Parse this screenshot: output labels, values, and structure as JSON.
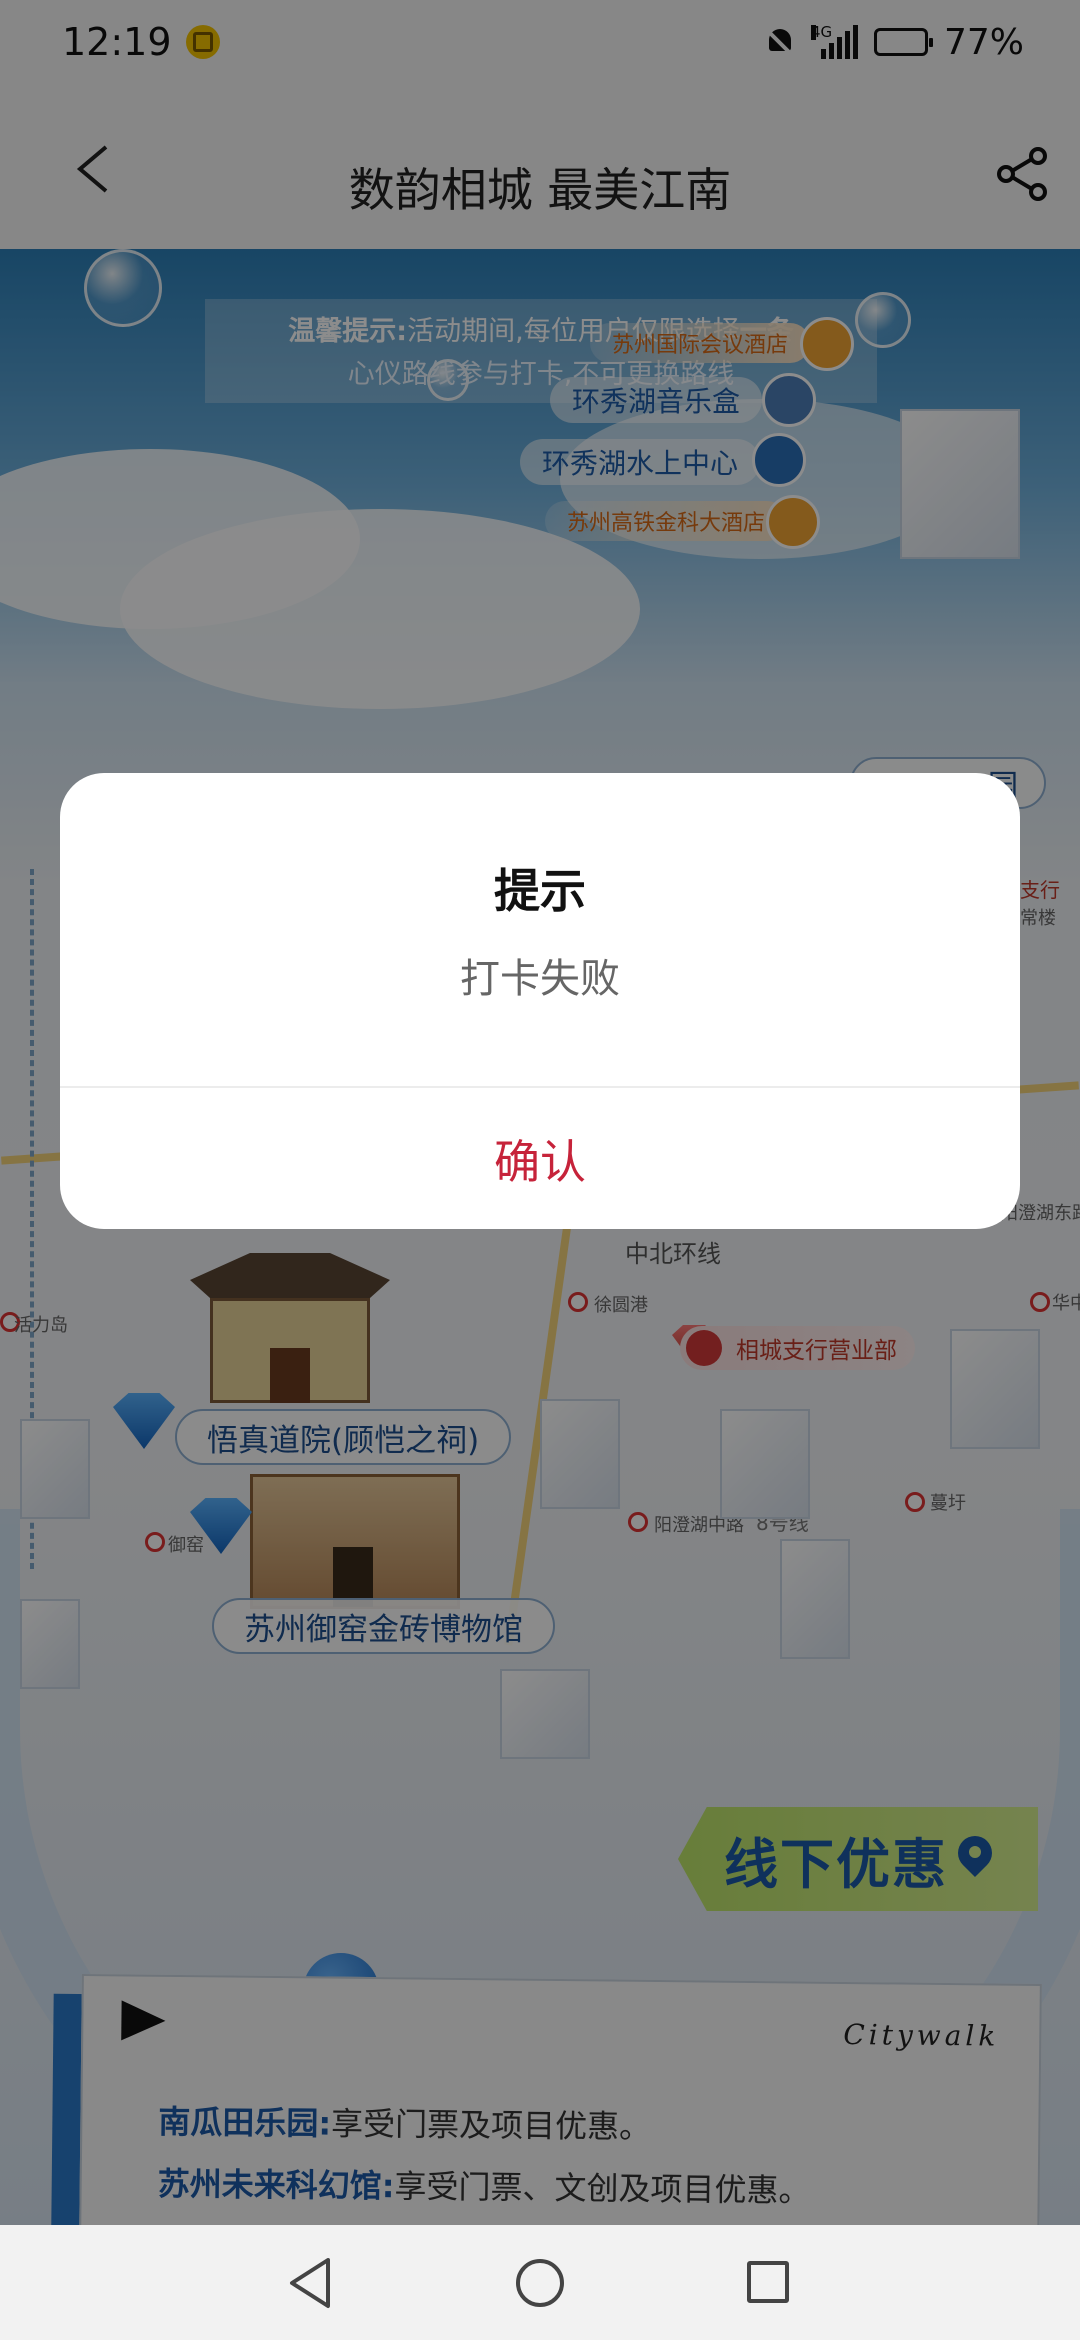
{
  "status_bar": {
    "time": "12:19",
    "network": "4G",
    "battery_percent_text": "77%",
    "battery_level": 0.77
  },
  "header": {
    "title": "数韵相城 最美江南"
  },
  "map": {
    "tip_prefix": "温馨提示:",
    "tip_text": "活动期间,每位用户仅限选择",
    "tip_emphasis": "一条",
    "tip_line2": "心仪路线参与打卡,不可更换路线",
    "places": [
      "苏州国际会议酒店",
      "环秀湖音乐盒",
      "环秀湖水上中心",
      "苏州高铁金科大酒店"
    ],
    "right_edge_labels": [
      "支行",
      "常楼",
      "园"
    ],
    "labels": {
      "metro_line": "中北环线",
      "line8": "8号线",
      "stop_xuyuangang": "徐圆港",
      "stop_huowoli": "活力岛",
      "stop_yangchenghu": "阳澄湖中路",
      "stop_manqiu": "蔓圩",
      "stop_yuyao": "御窑",
      "stop_huazhong": "华中",
      "stop_yangchenghu_east": "阳澄湖东路"
    },
    "branch": "相城支行营业部",
    "landmark_1": "悟真道院(顾恺之祠)",
    "landmark_2": "苏州御窑金砖博物馆",
    "promo_tag": "线下优惠",
    "citywalk": "Citywalk",
    "promo_items": [
      {
        "name": "南瓜田乐园:",
        "desc": "享受门票及项目优惠。"
      },
      {
        "name": "苏州未来科幻馆:",
        "desc": "享受门票、文创及项目优惠。"
      }
    ]
  },
  "dialog": {
    "title": "提示",
    "message": "打卡失败",
    "confirm_label": "确认"
  },
  "nav": {
    "back": "back-triangle",
    "home": "home-circle",
    "recents": "recents-square"
  },
  "colors": {
    "confirm": "#c6233a",
    "brand_blue": "#1c5aa8",
    "promo_green": "#bde56a"
  }
}
